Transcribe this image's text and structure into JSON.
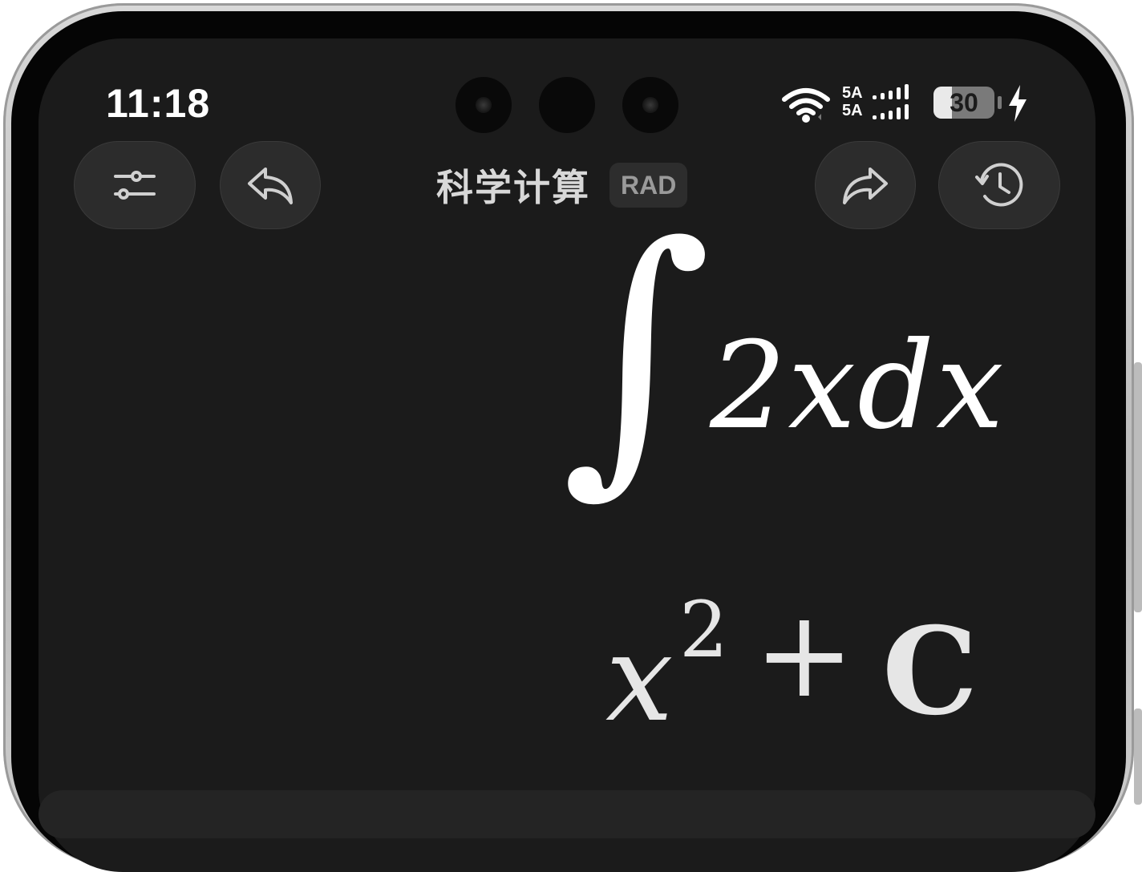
{
  "status_bar": {
    "time": "11:18",
    "signal_label_1": "5A",
    "signal_label_2": "5A",
    "battery": "30",
    "battery_fraction": 0.3,
    "icons": [
      "wifi-icon",
      "signal-icon",
      "battery-icon",
      "charging-icon"
    ]
  },
  "header": {
    "title": "科学计算",
    "mode_badge": "RAD",
    "buttons": [
      "settings-sliders-icon",
      "undo-icon",
      "redo-icon",
      "history-icon"
    ]
  },
  "display": {
    "integral_symbol": "∫",
    "integrand": "2xdx",
    "result_base": "x",
    "result_exponent": "2",
    "result_operator": "+",
    "result_constant": "C"
  },
  "colors": {
    "screen_bg": "#1b1b1b",
    "button_bg": "#2c2c2c",
    "text_primary": "#ffffff",
    "badge_text": "#9a9a9a"
  }
}
